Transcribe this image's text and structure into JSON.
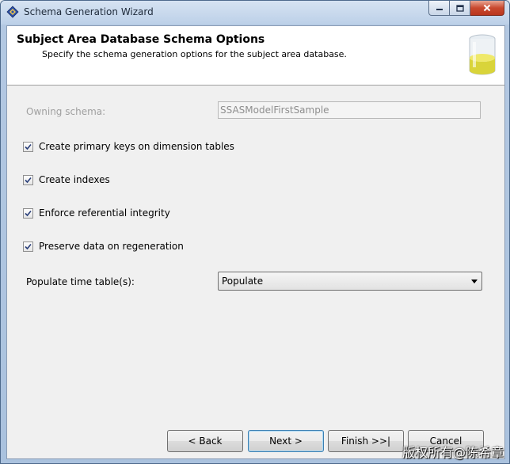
{
  "window": {
    "title": "Schema Generation Wizard",
    "app_icon": "wizard-diamond-icon",
    "controls": {
      "minimize": "minimize-icon",
      "maximize": "maximize-icon",
      "close": "close-icon"
    }
  },
  "header": {
    "title": "Subject Area Database Schema Options",
    "subtitle": "Specify the schema generation options for the subject area database.",
    "icon": "database-cylinder-icon"
  },
  "form": {
    "owning_schema": {
      "label": "Owning schema:",
      "value": "SSASModelFirstSample",
      "disabled": true
    },
    "options": [
      {
        "label": "Create primary keys on dimension tables",
        "checked": true
      },
      {
        "label": "Create indexes",
        "checked": true
      },
      {
        "label": "Enforce referential integrity",
        "checked": true
      },
      {
        "label": "Preserve data on regeneration",
        "checked": true
      }
    ],
    "populate": {
      "label": "Populate time table(s):",
      "selected": "Populate"
    }
  },
  "buttons": {
    "back": "< Back",
    "next": "Next >",
    "finish": "Finish >>|",
    "cancel": "Cancel"
  },
  "watermark": "版权所有@陈希章",
  "colors": {
    "title_bar": "#bcd0e8",
    "close_button": "#c9492f",
    "default_button_border": "#3c7fb1"
  }
}
